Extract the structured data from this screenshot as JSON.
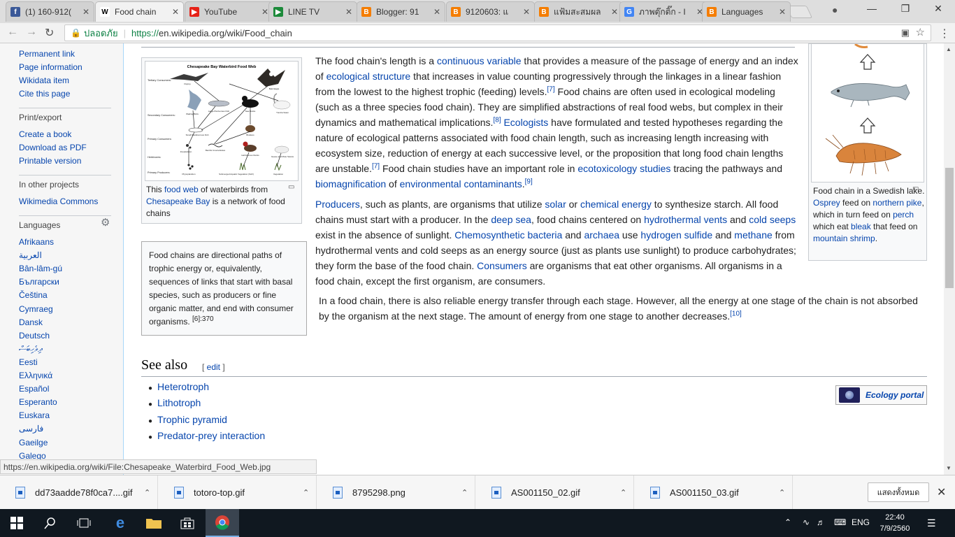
{
  "tabs": [
    {
      "title": "(1) 160-912(",
      "favicon": "f",
      "color": "#3b5998"
    },
    {
      "title": "Food chain",
      "favicon": "W",
      "color": "#ffffff",
      "active": true
    },
    {
      "title": "YouTube",
      "favicon": "▶",
      "color": "#e62117"
    },
    {
      "title": "LINE TV",
      "favicon": "▶",
      "color": "#1c8a3a"
    },
    {
      "title": "Blogger: 91",
      "favicon": "B",
      "color": "#f57d00"
    },
    {
      "title": "9120603: แ",
      "favicon": "B",
      "color": "#f57d00"
    },
    {
      "title": "แฟ้มสะสมผล",
      "favicon": "B",
      "color": "#f57d00"
    },
    {
      "title": "ภาพตุ๊กติ๊ก - I",
      "favicon": "G",
      "color": "#4285f4"
    },
    {
      "title": "Languages",
      "favicon": "B",
      "color": "#f57d00"
    }
  ],
  "address": {
    "secure_label": "ปลอดภัย",
    "url_scheme": "https://",
    "url_rest": "en.wikipedia.org/wiki/Food_chain"
  },
  "sidebar": {
    "tools": [
      "Permanent link",
      "Page information",
      "Wikidata item",
      "Cite this page"
    ],
    "print_heading": "Print/export",
    "print": [
      "Create a book",
      "Download as PDF",
      "Printable version"
    ],
    "projects_heading": "In other projects",
    "projects": [
      "Wikimedia Commons"
    ],
    "languages_heading": "Languages",
    "languages": [
      "Afrikaans",
      "العربية",
      "Bân-lâm-gú",
      "Български",
      "Čeština",
      "Cymraeg",
      "Dansk",
      "Deutsch",
      "ދިވެހިބަސް",
      "Eesti",
      "Ελληνικά",
      "Español",
      "Esperanto",
      "Euskara",
      "فارسی",
      "Gaeilge",
      "Galego"
    ]
  },
  "thumb_left": {
    "img_title": "Chesapeake Bay Waterbird Food Web",
    "levels": [
      "Tertiary Consumers:",
      "Secondary Consumers:",
      "Primary Consumers:",
      "Herbivores:",
      "Primary Producers:"
    ],
    "organisms": [
      "Osprey",
      "Bald Eagle",
      "Wading Birds",
      "Large Piscivorous Fish",
      "Sea Ducks",
      "Tundra Swan",
      "Small Planktivorous Fish",
      "Bivalves",
      "Zooplankton",
      "Benthic Invertebrates",
      "Herbivorous Ducks",
      "Geese and Mute Swans",
      "Phytoplankton",
      "Submerged Aquatic Vegetation (SAV)",
      "Vegetation"
    ],
    "cap_a": "This ",
    "cap_link1": "food web",
    "cap_b": " of waterbirds from ",
    "cap_link2": "Chesapeake Bay",
    "cap_c": " is a network of food chains"
  },
  "quote": {
    "text": "Food chains are directional paths of trophic energy or, equivalently, sequences of links that start with basal species, such as producers or fine organic matter, and end with consumer organisms.",
    "ref": "[6]:370"
  },
  "thumb_right": {
    "cap": [
      {
        "t": "Food chain in a Swedish lake. "
      },
      {
        "t": "Osprey",
        "link": true
      },
      {
        "t": " feed on "
      },
      {
        "t": "northern pike",
        "link": true
      },
      {
        "t": ", which in turn feed on "
      },
      {
        "t": "perch",
        "link": true
      },
      {
        "t": " which eat "
      },
      {
        "t": "bleak",
        "link": true
      },
      {
        "t": " that feed on "
      },
      {
        "t": "mountain shrimp",
        "link": true
      },
      {
        "t": "."
      }
    ]
  },
  "paragraphs": {
    "p1": [
      {
        "t": "The food chain's length is a "
      },
      {
        "t": "continuous variable",
        "link": true
      },
      {
        "t": " that provides a measure of the passage of energy and an index of "
      },
      {
        "t": "ecological structure",
        "link": true
      },
      {
        "t": " that increases in value counting progressively through the linkages in a linear fashion from the lowest to the highest trophic (feeding) levels."
      },
      {
        "t": "[7]",
        "sup": true
      },
      {
        "t": " Food chains are often used in ecological modeling (such as a three species food chain). They are simplified abstractions of real food webs, but complex in their dynamics and mathematical implications."
      },
      {
        "t": "[8]",
        "sup": true
      },
      {
        "t": " "
      },
      {
        "t": "Ecologists",
        "link": true
      },
      {
        "t": " have formulated and tested hypotheses regarding the nature of ecological patterns associated with food chain length, such as increasing length increasing with ecosystem size, reduction of energy at each successive level, or the proposition that long food chain lengths are unstable."
      },
      {
        "t": "[7]",
        "sup": true
      },
      {
        "t": " Food chain studies have an important role in "
      },
      {
        "t": "ecotoxicology studies",
        "link": true
      },
      {
        "t": " tracing the pathways and "
      },
      {
        "t": "biomagnification",
        "link": true
      },
      {
        "t": " of "
      },
      {
        "t": "environmental contaminants",
        "link": true
      },
      {
        "t": "."
      },
      {
        "t": "[9]",
        "sup": true
      }
    ],
    "p2": [
      {
        "t": "Producers",
        "link": true
      },
      {
        "t": ", such as plants, are organisms that utilize "
      },
      {
        "t": "solar",
        "link": true
      },
      {
        "t": " or "
      },
      {
        "t": "chemical energy",
        "link": true
      },
      {
        "t": " to synthesize starch. All food chains must start with a producer. In the "
      },
      {
        "t": "deep sea",
        "link": true
      },
      {
        "t": ", food chains centered on "
      },
      {
        "t": "hydrothermal vents",
        "link": true
      },
      {
        "t": " and "
      },
      {
        "t": "cold seeps",
        "link": true
      },
      {
        "t": " exist in the absence of sunlight. "
      },
      {
        "t": "Chemosynthetic bacteria",
        "link": true
      },
      {
        "t": " and "
      },
      {
        "t": "archaea",
        "link": true
      },
      {
        "t": " use "
      },
      {
        "t": "hydrogen sulfide",
        "link": true
      },
      {
        "t": " and "
      },
      {
        "t": "methane",
        "link": true
      },
      {
        "t": " from hydrothermal vents and cold seeps as an energy source (just as plants use sunlight) to produce carbohydrates; they form the base of the food chain. "
      },
      {
        "t": "Consumers",
        "link": true
      },
      {
        "t": " are organisms that eat other organisms. All organisms in a food chain, except the first organism, are consumers."
      }
    ],
    "p3": [
      {
        "t": "In a food chain, there is also reliable energy transfer through each stage. However, all the energy at one stage of the chain is not absorbed by the organism at the next stage. The amount of energy from one stage to another decreases."
      },
      {
        "t": "[10]",
        "sup": true
      }
    ]
  },
  "see_also": {
    "heading": "See also",
    "edit": "edit",
    "items": [
      "Heterotroph",
      "Lithotroph",
      "Trophic pyramid",
      "Predator-prey interaction"
    ],
    "portal": "Ecology portal"
  },
  "status_url": "https://en.wikipedia.org/wiki/File:Chesapeake_Waterbird_Food_Web.jpg",
  "downloads": {
    "items": [
      "dd73aadde78f0ca7....gif",
      "totoro-top.gif",
      "8795298.png",
      "AS001150_02.gif",
      "AS001150_03.gif"
    ],
    "show_all": "แสดงทั้งหมด"
  },
  "taskbar": {
    "lang": "ENG",
    "time": "22:40",
    "date": "7/9/2560"
  }
}
